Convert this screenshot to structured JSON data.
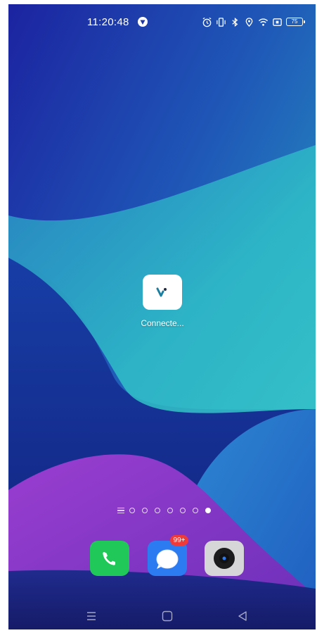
{
  "status_bar": {
    "time": "11:20:48",
    "left_icon": "vpn-shield-icon",
    "right_icons": [
      "alarm-icon",
      "vibrate-icon",
      "bluetooth-icon",
      "location-icon",
      "wifi-icon",
      "sim-icon"
    ],
    "battery_level": "75"
  },
  "home_screen": {
    "apps": [
      {
        "label": "Connecte...",
        "icon": "connected-app-icon"
      }
    ],
    "page_indicator": {
      "pages": 7,
      "active_page": 7
    }
  },
  "dock": {
    "apps": [
      {
        "name": "phone",
        "icon": "phone-icon",
        "color": "#20c759"
      },
      {
        "name": "messages",
        "icon": "message-bubble-icon",
        "color": "#2d7bf0",
        "badge": "99+"
      },
      {
        "name": "camera",
        "icon": "camera-icon",
        "color": "#d6d6d8"
      }
    ]
  },
  "nav_bar": {
    "buttons": [
      "menu-icon",
      "home-icon",
      "back-icon"
    ]
  },
  "colors": {
    "wallpaper_top": "#1d2fa8",
    "wallpaper_teal": "#2fc0c8",
    "wallpaper_purple": "#a84fd6",
    "badge": "#f03a3a"
  }
}
